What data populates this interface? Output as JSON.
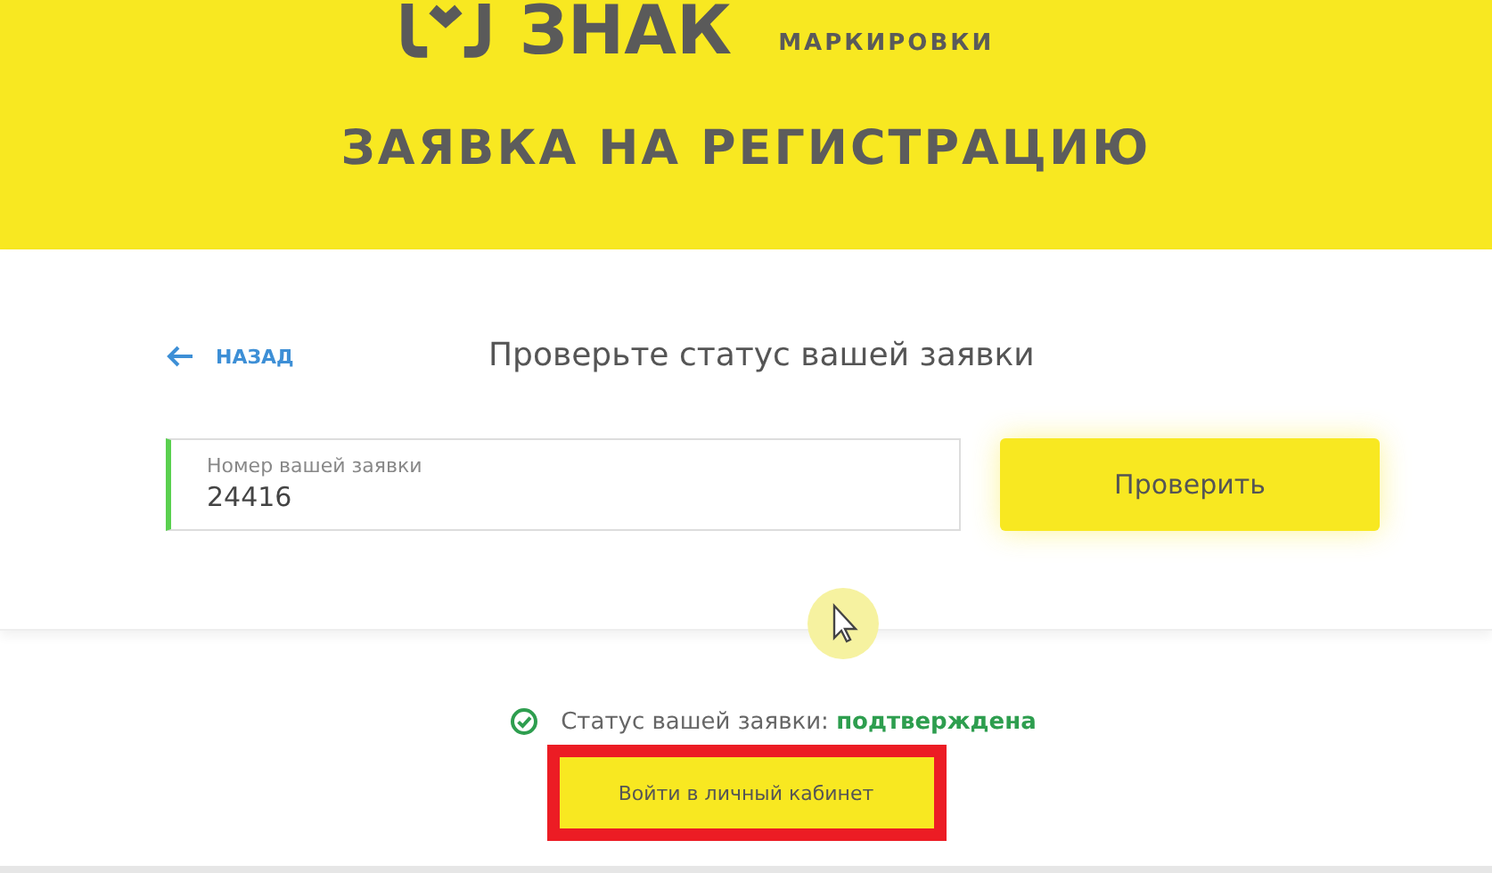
{
  "header": {
    "logo_word": "ЗНАК",
    "logo_caption": "МАРКИРОВКИ",
    "title": "ЗАЯВКА НА РЕГИСТРАЦИЮ"
  },
  "check_form": {
    "back_link": "НАЗАД",
    "heading": "Проверьте статус вашей заявки",
    "field": {
      "label": "Номер вашей заявки",
      "value": "24416",
      "focused": true
    },
    "submit_button": "Проверить"
  },
  "result": {
    "status_text": "Статус вашей заявки: **подтверждена**",
    "login_button": {
      "label": "Войти в личный кабинет",
      "highlighted": true
    }
  }
}
